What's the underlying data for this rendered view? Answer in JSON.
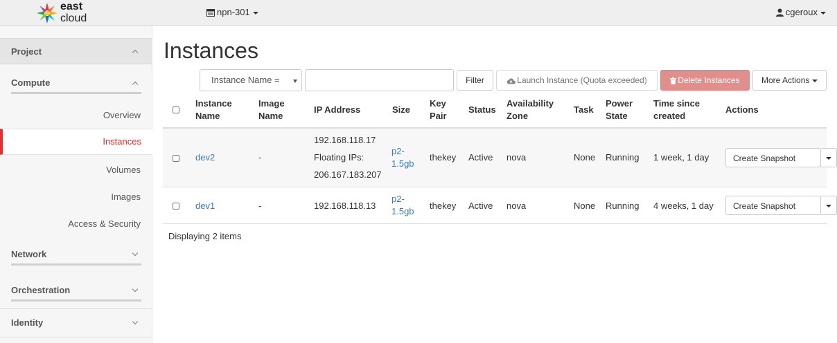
{
  "brand": {
    "word1": "east",
    "word2": "cloud"
  },
  "navbar": {
    "project": "npn-301",
    "user": "cgeroux"
  },
  "sidebar": {
    "project": "Project",
    "compute": "Compute",
    "items": [
      "Overview",
      "Instances",
      "Volumes",
      "Images",
      "Access & Security"
    ],
    "network": "Network",
    "orchestration": "Orchestration",
    "identity": "Identity"
  },
  "page": {
    "title": "Instances"
  },
  "toolbar": {
    "filter_select": "Instance Name =",
    "search_value": "",
    "filter": "Filter",
    "launch": "Launch Instance (Quota exceeded)",
    "delete": "Delete Instances",
    "more": "More Actions"
  },
  "table": {
    "headers": {
      "name1": "Instance",
      "name2": "Name",
      "image1": "Image",
      "image2": "Name",
      "ip": "IP Address",
      "size": "Size",
      "key1": "Key",
      "key2": "Pair",
      "status": "Status",
      "az1": "Availability",
      "az2": "Zone",
      "task": "Task",
      "power1": "Power",
      "power2": "State",
      "time1": "Time since",
      "time2": "created",
      "actions": "Actions"
    },
    "rows": [
      {
        "name": "dev2",
        "image": "-",
        "ip": "192.168.118.17",
        "floating_label": "Floating IPs:",
        "floating_ip": "206.167.183.207",
        "size1": "p2-",
        "size2": "1.5gb",
        "key": "thekey",
        "status": "Active",
        "az": "nova",
        "task": "None",
        "power": "Running",
        "time": "1 week, 1 day",
        "action": "Create Snapshot"
      },
      {
        "name": "dev1",
        "image": "-",
        "ip": "192.168.118.13",
        "size1": "p2-",
        "size2": "1.5gb",
        "key": "thekey",
        "status": "Active",
        "az": "nova",
        "task": "None",
        "power": "Running",
        "time": "4 weeks, 1 day",
        "action": "Create Snapshot"
      }
    ],
    "footer": "Displaying 2 items"
  },
  "colors": {
    "accent": "#d6322b",
    "link": "#3a7bbf",
    "danger_button": "#e08f8c"
  }
}
